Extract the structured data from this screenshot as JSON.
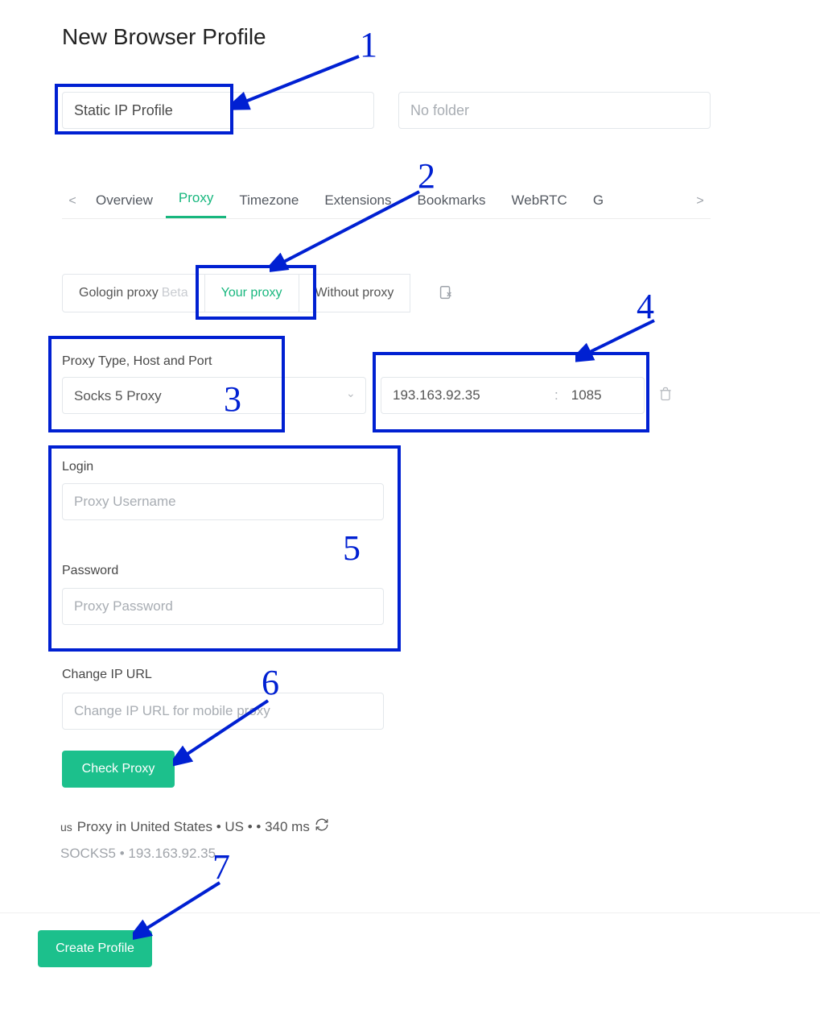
{
  "page_title": "New Browser Profile",
  "profile_name": {
    "value": "Static IP Profile"
  },
  "profile_folder": {
    "placeholder": "No folder"
  },
  "tabs": {
    "chev_left": "<",
    "chev_right": ">",
    "items": [
      {
        "label": "Overview"
      },
      {
        "label": "Proxy",
        "active": true
      },
      {
        "label": "Timezone"
      },
      {
        "label": "Extensions"
      },
      {
        "label": "Bookmarks"
      },
      {
        "label": "WebRTC"
      },
      {
        "label": "G"
      }
    ]
  },
  "proxy_source": {
    "options": [
      {
        "label": "Gologin proxy",
        "suffix": "Beta"
      },
      {
        "label": "Your proxy",
        "active": true
      },
      {
        "label": "Without proxy"
      }
    ]
  },
  "proxy_type": {
    "label": "Proxy Type, Host and Port",
    "selected": "Socks 5 Proxy",
    "host": "193.163.92.35",
    "port_sep": ":",
    "port": "1085"
  },
  "login": {
    "label": "Login",
    "placeholder": "Proxy Username"
  },
  "password": {
    "label": "Password",
    "placeholder": "Proxy Password"
  },
  "change_ip": {
    "label": "Change IP URL",
    "placeholder": "Change IP URL for mobile proxy"
  },
  "buttons": {
    "check": "Check Proxy",
    "create": "Create Profile"
  },
  "status": {
    "flag": "us",
    "line1": "Proxy in United States • US • • 340 ms",
    "line2": "SOCKS5 • 193.163.92.35"
  },
  "annotations": {
    "n1": "1",
    "n2": "2",
    "n3": "3",
    "n4": "4",
    "n5": "5",
    "n6": "6",
    "n7": "7"
  }
}
